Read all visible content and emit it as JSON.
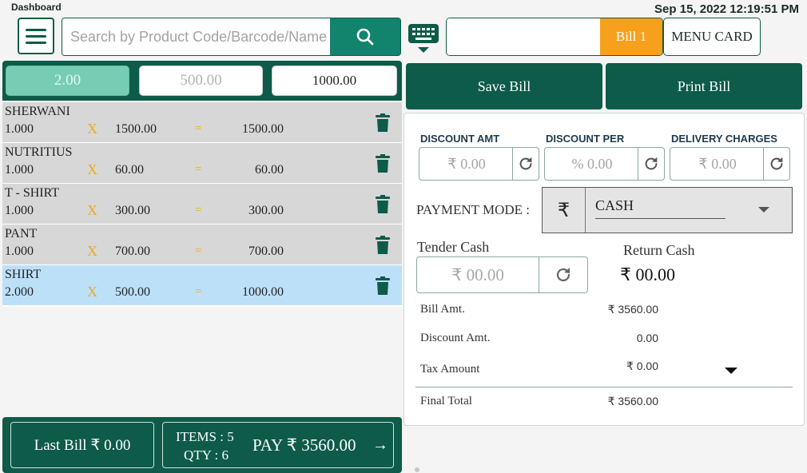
{
  "header": {
    "title": "Dashboard",
    "datetime": "Sep 15, 2022 12:19:51 PM"
  },
  "search": {
    "placeholder": "Search by Product Code/Barcode/Name"
  },
  "bill": {
    "tab_label": "Bill 1",
    "menu_card_label": "MENU CARD"
  },
  "quick_amounts": [
    "2.00",
    "500.00",
    "1000.00"
  ],
  "items": [
    {
      "name": "SHERWANI",
      "qty": "1.000",
      "x": "X",
      "price": "1500.00",
      "eq": "=",
      "total": "1500.00"
    },
    {
      "name": "NUTRITIUS",
      "qty": "1.000",
      "x": "X",
      "price": "60.00",
      "eq": "=",
      "total": "60.00"
    },
    {
      "name": "T - SHIRT",
      "qty": "1.000",
      "x": "X",
      "price": "300.00",
      "eq": "=",
      "total": "300.00"
    },
    {
      "name": "PANT",
      "qty": "1.000",
      "x": "X",
      "price": "700.00",
      "eq": "=",
      "total": "700.00"
    },
    {
      "name": "SHIRT",
      "qty": "2.000",
      "x": "X",
      "price": "500.00",
      "eq": "=",
      "total": "1000.00"
    }
  ],
  "footer": {
    "last_bill": "Last Bill ₹ 0.00",
    "items": "ITEMS : 5",
    "qty": "QTY : 6",
    "pay": "PAY ₹ 3560.00",
    "pay_arrow": "→"
  },
  "actions": {
    "save": "Save Bill",
    "print": "Print Bill"
  },
  "discount": {
    "amt_label": "DISCOUNT AMT",
    "amt_value": "₹ 0.00",
    "per_label": "DISCOUNT PER",
    "per_value": "% 0.00",
    "delivery_label": "DELIVERY CHARGES",
    "delivery_value": "₹ 0.00"
  },
  "payment": {
    "label": "PAYMENT MODE :",
    "currency_symbol": "₹",
    "mode": "CASH"
  },
  "tender": {
    "label": "Tender Cash",
    "value": "₹ 00.00",
    "return_label": "Return Cash",
    "return_value": "₹ 00.00"
  },
  "summary": {
    "bill_amt_label": "Bill Amt.",
    "bill_amt": "₹ 3560.00",
    "discount_label": "Discount Amt.",
    "discount": "0.00",
    "tax_label": "Tax Amount",
    "tax": "₹ 0.00",
    "final_label": "Final Total",
    "final": "₹ 3560.00"
  },
  "colors": {
    "primary": "#0d5b48",
    "search_button": "#12836d",
    "accent": "#f7a01c",
    "selected_row": "#bde0f9",
    "row": "#d7d7d7"
  }
}
